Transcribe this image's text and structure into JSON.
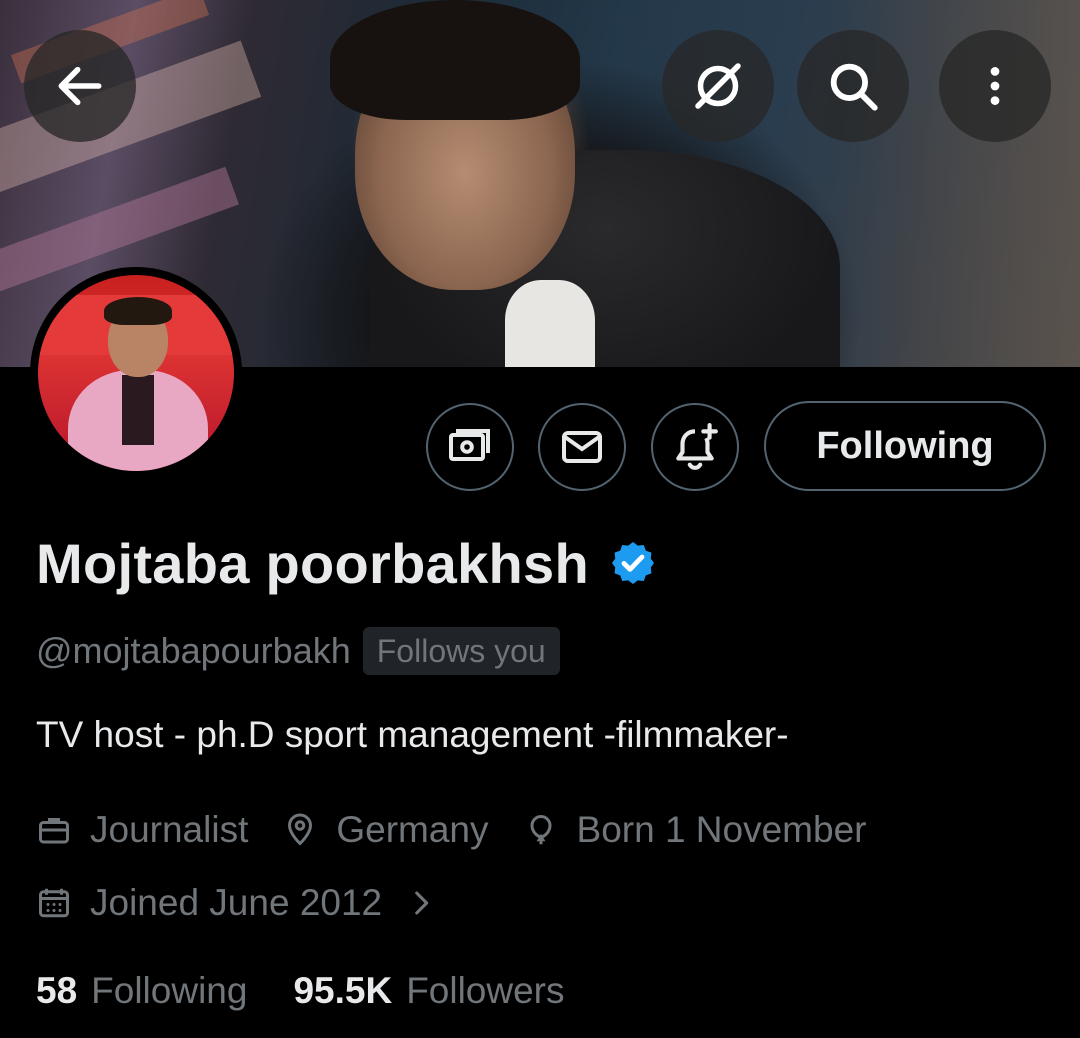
{
  "header": {
    "back_icon": "arrow-left-icon",
    "grok_icon": "grok-slash-circle-icon",
    "search_icon": "search-icon",
    "more_icon": "more-vertical-icon"
  },
  "actions": {
    "tip_icon": "money-icon",
    "message_icon": "envelope-icon",
    "notify_icon": "bell-plus-icon",
    "following_label": "Following"
  },
  "profile": {
    "display_name": "Mojtaba poorbakhsh",
    "verified_color": "#1d9bf0",
    "handle": "@mojtabapourbakh",
    "follows_you": "Follows you",
    "bio": "TV host - ph.D sport management -filmmaker-",
    "profession": "Journalist",
    "location": "Germany",
    "birthday": "Born 1 November",
    "joined": "Joined June 2012"
  },
  "stats": {
    "following_count": "58",
    "following_label": "Following",
    "followers_count": "95.5K",
    "followers_label": "Followers"
  },
  "colors": {
    "background": "#000000",
    "text_primary": "#e7e9ea",
    "text_secondary": "#71767b",
    "border": "#536471"
  }
}
